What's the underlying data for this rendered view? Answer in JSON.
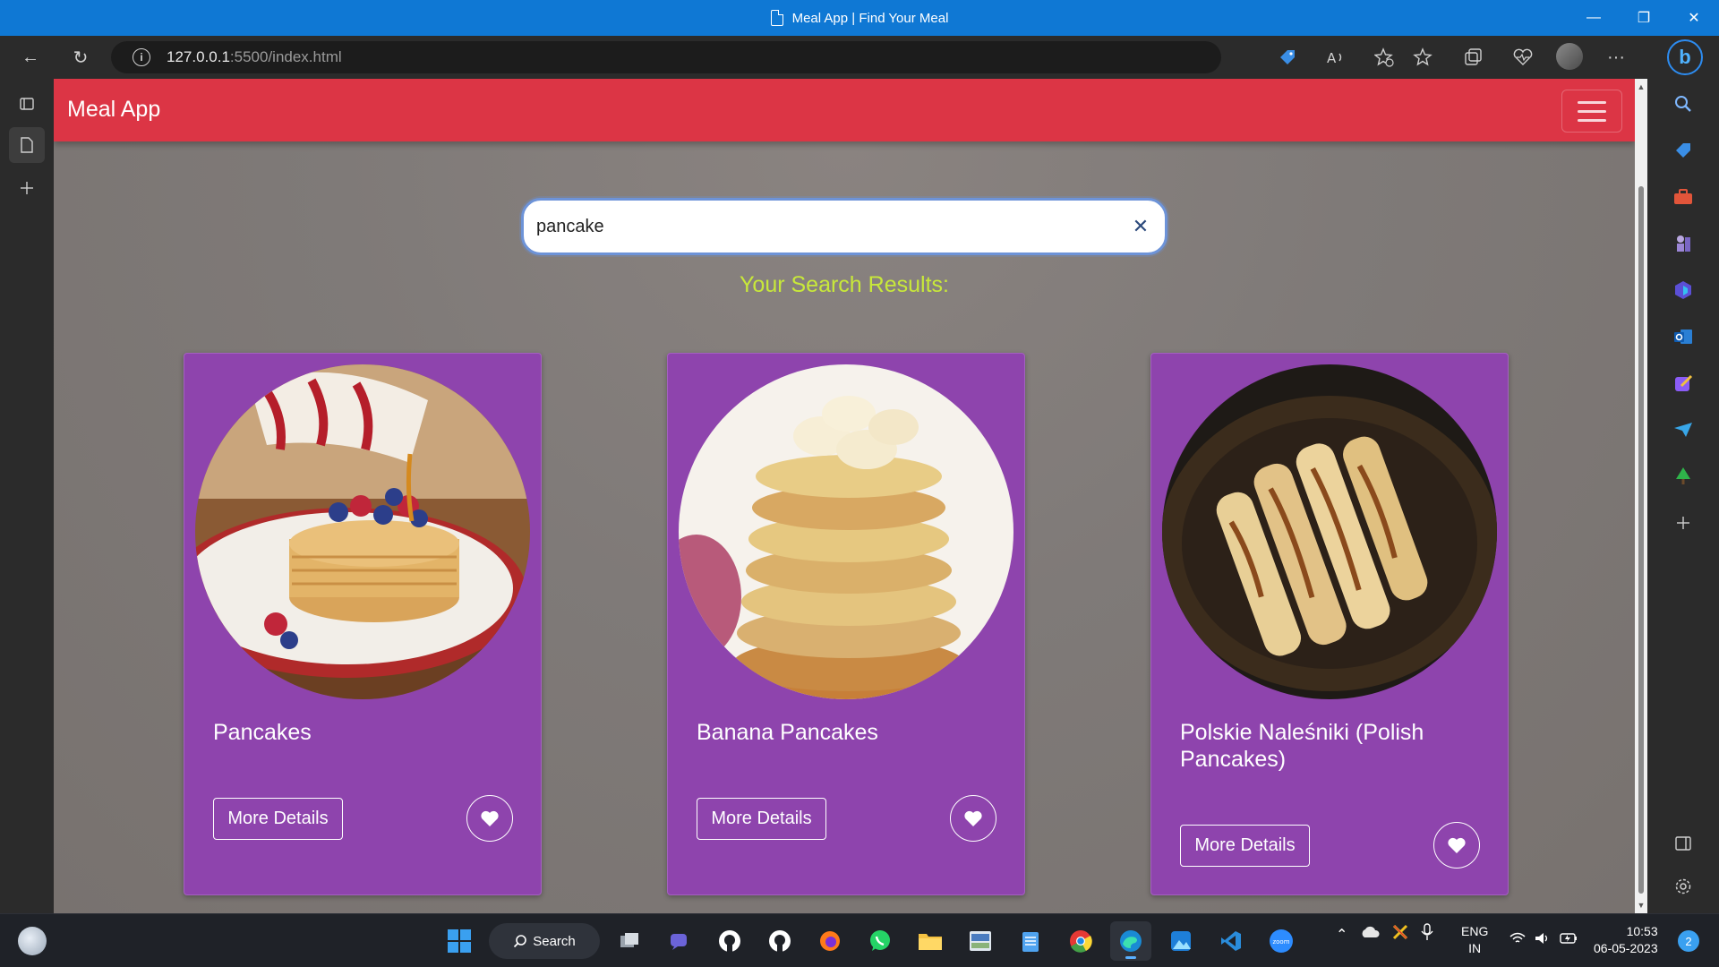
{
  "window": {
    "title": "Meal App | Find Your Meal",
    "minimize": "—",
    "maximize": "❐",
    "close": "✕"
  },
  "browser": {
    "url_host": "127.0.0.1",
    "url_path": ":5500/index.html",
    "info_glyph": "i",
    "back_glyph": "←",
    "reload_glyph": "↻",
    "more_glyph": "···",
    "bing_glyph": "b"
  },
  "app": {
    "brand": "Meal App",
    "search": {
      "value": "pancake",
      "clear_glyph": "✕"
    },
    "results_heading": "Your Search Results:",
    "meals": [
      {
        "name": "Pancakes",
        "more_label": "More Details"
      },
      {
        "name": "Banana Pancakes",
        "more_label": "More Details"
      },
      {
        "name": "Polskie Naleśniki (Polish Pancakes)",
        "more_label": "More Details"
      }
    ]
  },
  "taskbar": {
    "search_label": "Search",
    "lang_line1": "ENG",
    "lang_line2": "IN",
    "time": "10:53",
    "date": "06-05-2023",
    "notification_count": "2",
    "zoom_label": "zoom"
  },
  "colors": {
    "navbar": "#dc3545",
    "card": "#8e44ad",
    "results_heading": "#c8e83a",
    "titlebar": "#0f78d4"
  }
}
